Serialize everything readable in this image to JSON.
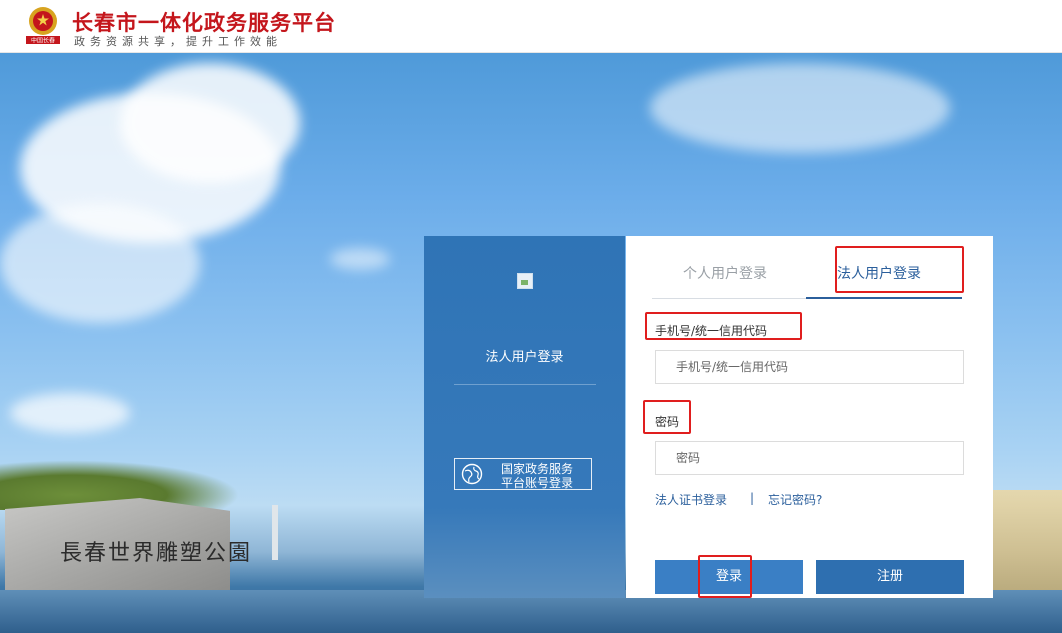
{
  "header": {
    "title": "长春市一体化政务服务平台",
    "slogan": "政务资源共享，提升工作效能",
    "emblem_caption": "中国长春"
  },
  "background": {
    "monument_text": "長春世界雕塑公園"
  },
  "left_panel": {
    "title": "法人用户登录",
    "gov_login_line1": "国家政务服务",
    "gov_login_line2": "平台账号登录"
  },
  "form": {
    "tabs": [
      {
        "label": "个人用户登录",
        "active": false
      },
      {
        "label": "法人用户登录",
        "active": true
      }
    ],
    "account_label": "手机号/统一信用代码",
    "account_placeholder": "手机号/统一信用代码",
    "password_label": "密码",
    "password_placeholder": "密码",
    "cert_login_link": "法人证书登录",
    "separator": "|",
    "forgot_password_link": "忘记密码?",
    "login_button": "登录",
    "register_button": "注册"
  },
  "colors": {
    "brand_red": "#c4161c",
    "primary_blue": "#2b5f9c",
    "panel_blue": "#2f74b6",
    "highlight_red": "#e01e1e"
  }
}
